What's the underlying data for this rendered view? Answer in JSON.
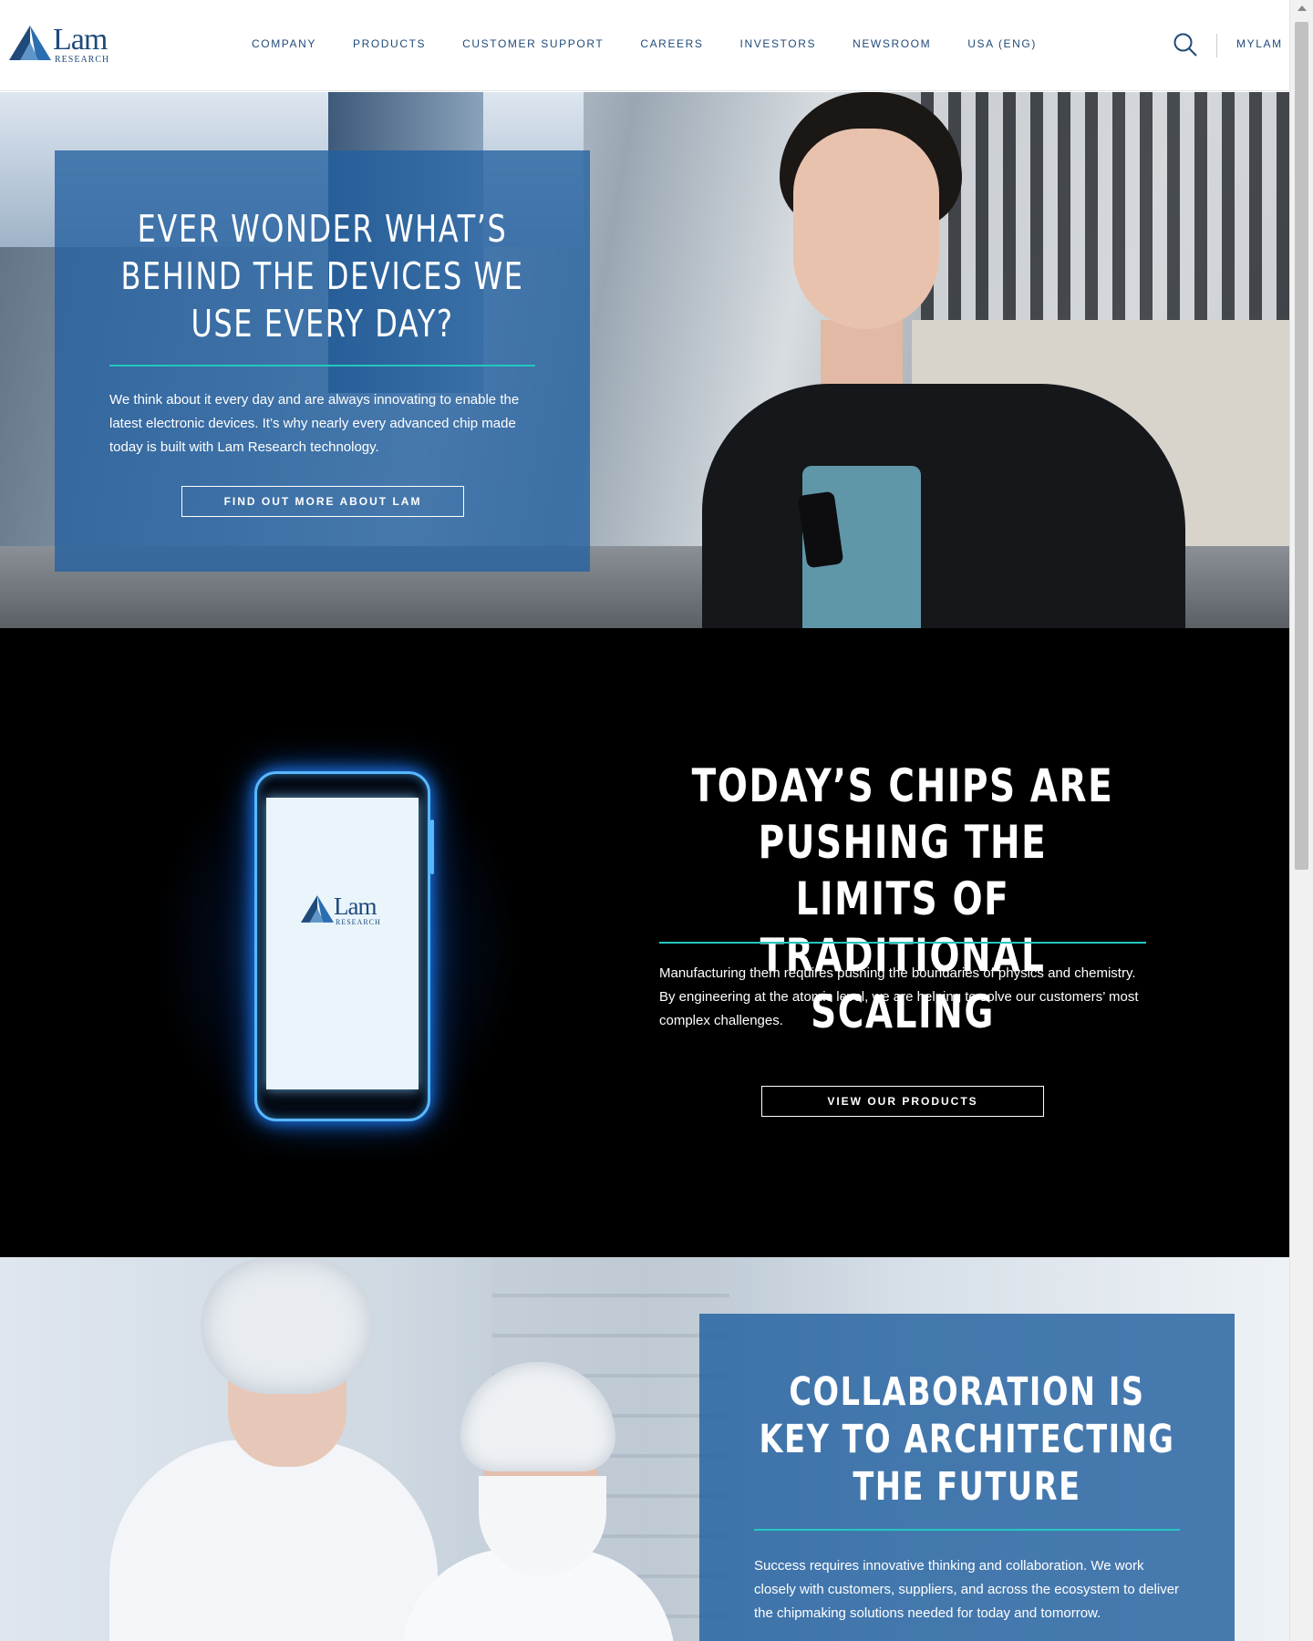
{
  "brand": {
    "name": "Lam",
    "sub": "RESEARCH",
    "color": "#1f4a7a"
  },
  "nav": {
    "items": [
      "COMPANY",
      "PRODUCTS",
      "CUSTOMER SUPPORT",
      "CAREERS",
      "INVESTORS",
      "NEWSROOM",
      "USA (ENG)"
    ],
    "mylam": "MYLAM",
    "search_icon": "search-icon"
  },
  "hero": {
    "title": "EVER WONDER WHAT’S BEHIND THE DEVICES WE USE EVERY DAY?",
    "body": "We think about it every day and are always innovating to enable the latest electronic devices. It’s why nearly every advanced chip made today is built with Lam Research technology.",
    "cta": "FIND OUT MORE ABOUT LAM"
  },
  "chips": {
    "title": "TODAY’S CHIPS ARE PUSHING THE LIMITS OF TRADITIONAL SCALING",
    "body": "Manufacturing them requires pushing the boundaries of physics and chemistry. By engineering at the atomic level, we are helping to solve our customers’ most complex challenges.",
    "cta": "VIEW OUR PRODUCTS"
  },
  "collab": {
    "title": "COLLABORATION IS KEY TO ARCHITECTING THE FUTURE",
    "body": "Success requires innovative thinking and collaboration. We work closely with customers, suppliers, and across the ecosystem to deliver the chipmaking solutions needed for today and tomorrow."
  },
  "colors": {
    "accent": "#24c7c0",
    "panel_blue": "#2260a0",
    "nav_text": "#1f4a7a",
    "phone_glow": "#1e7fff"
  }
}
